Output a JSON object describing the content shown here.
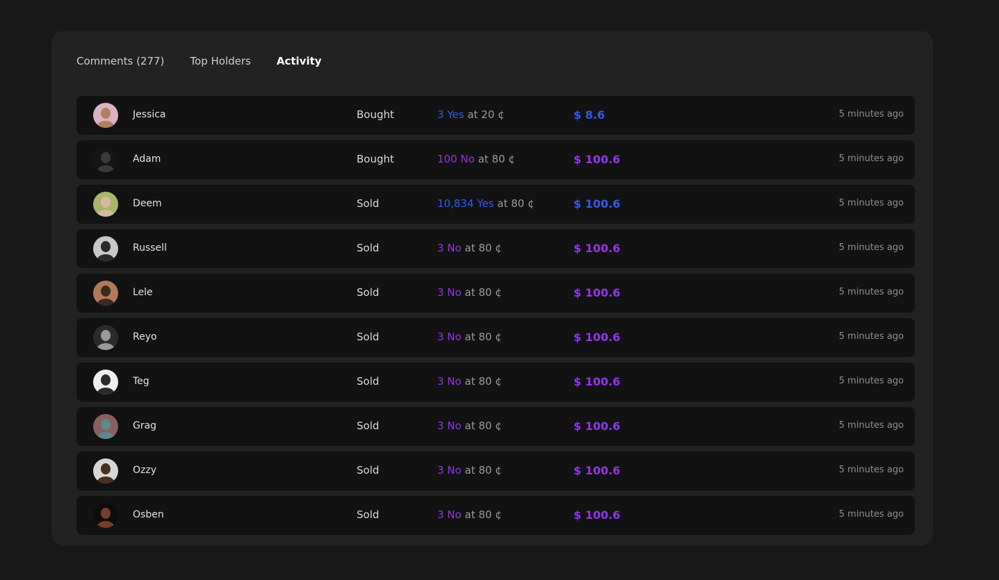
{
  "tabs": [
    {
      "label": "Comments (277)",
      "active": false
    },
    {
      "label": "Top Holders",
      "active": false
    },
    {
      "label": "Activity",
      "active": true
    }
  ],
  "colors": {
    "yes": "#2f5bea",
    "no": "#9333ea"
  },
  "activity": [
    {
      "name": "Jessica",
      "action": "Bought",
      "qty": "3 Yes",
      "at": "at 20 ¢",
      "amount": "$ 8.6",
      "side": "yes",
      "time": "5 minutes ago",
      "avatar_icon": "avatar-jessica",
      "avatar_bg": "#d9b3c4",
      "avatar_fg": "#b08060"
    },
    {
      "name": "Adam",
      "action": "Bought",
      "qty": "100 No",
      "at": "at 80 ¢",
      "amount": "$ 100.6",
      "side": "no",
      "time": "5 minutes ago",
      "avatar_icon": "avatar-adam",
      "avatar_bg": "#151515",
      "avatar_fg": "#3a3a3a"
    },
    {
      "name": "Deem",
      "action": "Sold",
      "qty": "10,834 Yes",
      "at": "at 80 ¢",
      "amount": "$ 100.6",
      "side": "yes",
      "time": "5 minutes ago",
      "avatar_icon": "avatar-deem",
      "avatar_bg": "#a9b56a",
      "avatar_fg": "#d8b8a0"
    },
    {
      "name": "Russell",
      "action": "Sold",
      "qty": "3 No",
      "at": "at 80 ¢",
      "amount": "$ 100.6",
      "side": "no",
      "time": "5 minutes ago",
      "avatar_icon": "avatar-russell",
      "avatar_bg": "#c8c8c8",
      "avatar_fg": "#2a2a2a"
    },
    {
      "name": "Lele",
      "action": "Sold",
      "qty": "3 No",
      "at": "at 80 ¢",
      "amount": "$ 100.6",
      "side": "no",
      "time": "5 minutes ago",
      "avatar_icon": "avatar-lele",
      "avatar_bg": "#b07a5a",
      "avatar_fg": "#3b2a22"
    },
    {
      "name": "Reyo",
      "action": "Sold",
      "qty": "3 No",
      "at": "at 80 ¢",
      "amount": "$ 100.6",
      "side": "no",
      "time": "5 minutes ago",
      "avatar_icon": "avatar-reyo",
      "avatar_bg": "#2b2b2b",
      "avatar_fg": "#9a9a9a"
    },
    {
      "name": "Teg",
      "action": "Sold",
      "qty": "3 No",
      "at": "at 80 ¢",
      "amount": "$ 100.6",
      "side": "no",
      "time": "5 minutes ago",
      "avatar_icon": "avatar-teg",
      "avatar_bg": "#efefef",
      "avatar_fg": "#2b2b2b"
    },
    {
      "name": "Grag",
      "action": "Sold",
      "qty": "3 No",
      "at": "at 80 ¢",
      "amount": "$ 100.6",
      "side": "no",
      "time": "5 minutes ago",
      "avatar_icon": "avatar-grag",
      "avatar_bg": "#8a5f5f",
      "avatar_fg": "#5c8a8f"
    },
    {
      "name": "Ozzy",
      "action": "Sold",
      "qty": "3 No",
      "at": "at 80 ¢",
      "amount": "$ 100.6",
      "side": "no",
      "time": "5 minutes ago",
      "avatar_icon": "avatar-ozzy",
      "avatar_bg": "#d7d7d7",
      "avatar_fg": "#4a2e1f"
    },
    {
      "name": "Osben",
      "action": "Sold",
      "qty": "3 No",
      "at": "at 80 ¢",
      "amount": "$ 100.6",
      "side": "no",
      "time": "5 minutes ago",
      "avatar_icon": "avatar-osben",
      "avatar_bg": "#0d0d0d",
      "avatar_fg": "#7a3c2a"
    }
  ]
}
